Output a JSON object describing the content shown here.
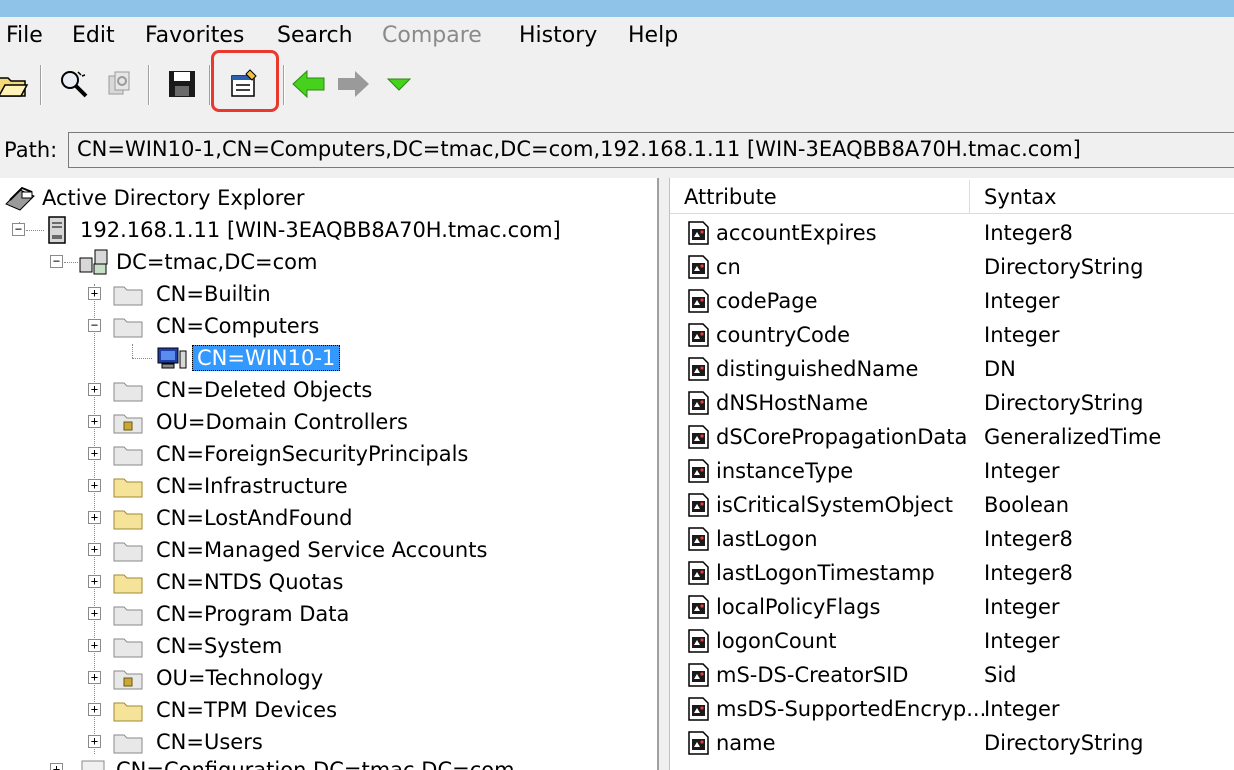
{
  "menu": {
    "items": [
      {
        "label": "File",
        "enabled": true
      },
      {
        "label": "Edit",
        "enabled": true
      },
      {
        "label": "Favorites",
        "enabled": true
      },
      {
        "label": "Search",
        "enabled": true
      },
      {
        "label": "Compare",
        "enabled": false
      },
      {
        "label": "History",
        "enabled": true
      },
      {
        "label": "Help",
        "enabled": true
      }
    ]
  },
  "toolbar": {
    "buttons": [
      {
        "icon": "open-folder-icon"
      },
      {
        "icon": "search-icon"
      },
      {
        "icon": "compare-icon"
      },
      {
        "icon": "save-icon"
      },
      {
        "icon": "properties-icon"
      },
      {
        "icon": "back-arrow-icon"
      },
      {
        "icon": "forward-arrow-icon"
      },
      {
        "icon": "history-dropdown-icon"
      }
    ],
    "highlight_color": "#e8392c"
  },
  "path": {
    "label": "Path:",
    "value": "CN=WIN10-1,CN=Computers,DC=tmac,DC=com,192.168.1.11 [WIN-3EAQBB8A70H.tmac.com]"
  },
  "tree": {
    "root": "Active Directory Explorer",
    "server": "192.168.1.11 [WIN-3EAQBB8A70H.tmac.com]",
    "domain": "DC=tmac,DC=com",
    "selected": "CN=WIN10-1",
    "nodes": [
      "CN=Builtin",
      "CN=Computers",
      "CN=WIN10-1",
      "CN=Deleted Objects",
      "OU=Domain Controllers",
      "CN=ForeignSecurityPrincipals",
      "CN=Infrastructure",
      "CN=LostAndFound",
      "CN=Managed Service Accounts",
      "CN=NTDS Quotas",
      "CN=Program Data",
      "CN=System",
      "OU=Technology",
      "CN=TPM Devices",
      "CN=Users"
    ],
    "partial": "CN=Configuration,DC=tmac,DC=com"
  },
  "attributes": {
    "columns": [
      "Attribute",
      "Syntax"
    ],
    "rows": [
      {
        "name": "accountExpires",
        "syntax": "Integer8"
      },
      {
        "name": "cn",
        "syntax": "DirectoryString"
      },
      {
        "name": "codePage",
        "syntax": "Integer"
      },
      {
        "name": "countryCode",
        "syntax": "Integer"
      },
      {
        "name": "distinguishedName",
        "syntax": "DN"
      },
      {
        "name": "dNSHostName",
        "syntax": "DirectoryString"
      },
      {
        "name": "dSCorePropagationData",
        "syntax": "GeneralizedTime"
      },
      {
        "name": "instanceType",
        "syntax": "Integer"
      },
      {
        "name": "isCriticalSystemObject",
        "syntax": "Boolean"
      },
      {
        "name": "lastLogon",
        "syntax": "Integer8"
      },
      {
        "name": "lastLogonTimestamp",
        "syntax": "Integer8"
      },
      {
        "name": "localPolicyFlags",
        "syntax": "Integer"
      },
      {
        "name": "logonCount",
        "syntax": "Integer"
      },
      {
        "name": "mS-DS-CreatorSID",
        "syntax": "Sid"
      },
      {
        "name": "msDS-SupportedEncryp...",
        "syntax": "Integer"
      },
      {
        "name": "name",
        "syntax": "DirectoryString"
      }
    ]
  }
}
